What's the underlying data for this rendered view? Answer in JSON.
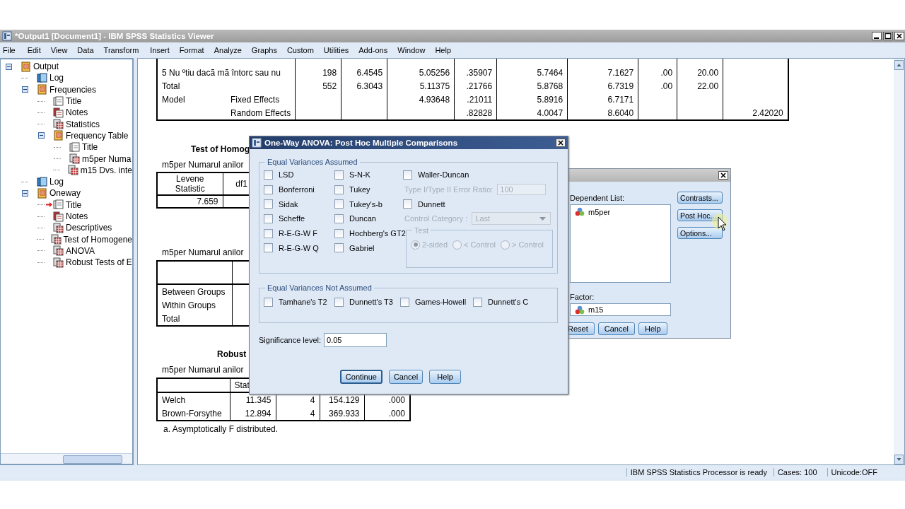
{
  "window": {
    "title": "*Output1 [Document1] - IBM SPSS Statistics Viewer"
  },
  "menu": [
    "File",
    "Edit",
    "View",
    "Data",
    "Transform",
    "Insert",
    "Format",
    "Analyze",
    "Graphs",
    "Custom",
    "Utilities",
    "Add-ons",
    "Window",
    "Help"
  ],
  "navigator": {
    "items": [
      {
        "label": "Output",
        "kind": "book",
        "current": false,
        "expanded": true,
        "children": [
          {
            "label": "Log",
            "kind": "log",
            "current": false
          },
          {
            "label": "Frequencies",
            "kind": "book",
            "current": false,
            "expanded": true,
            "children": [
              {
                "label": "Title",
                "kind": "title",
                "current": false
              },
              {
                "label": "Notes",
                "kind": "notes",
                "current": false
              },
              {
                "label": "Statistics",
                "kind": "table",
                "current": false
              },
              {
                "label": "Frequency Table",
                "kind": "book",
                "current": false,
                "expanded": true,
                "children": [
                  {
                    "label": "Title",
                    "kind": "title",
                    "current": false
                  },
                  {
                    "label": "m5per Numa",
                    "kind": "table",
                    "current": false
                  },
                  {
                    "label": "m15 Dvs. inte",
                    "kind": "table",
                    "current": false
                  }
                ]
              }
            ]
          },
          {
            "label": "Log",
            "kind": "log",
            "current": false
          },
          {
            "label": "Oneway",
            "kind": "book",
            "current": false,
            "expanded": true,
            "children": [
              {
                "label": "Title",
                "kind": "title",
                "current": true
              },
              {
                "label": "Notes",
                "kind": "notes",
                "current": false
              },
              {
                "label": "Descriptives",
                "kind": "table",
                "current": false
              },
              {
                "label": "Test of Homogene",
                "kind": "table",
                "current": false
              },
              {
                "label": "ANOVA",
                "kind": "table",
                "current": false
              },
              {
                "label": "Robust Tests of E",
                "kind": "table",
                "current": false
              }
            ]
          }
        ]
      }
    ]
  },
  "output": {
    "descriptives": {
      "rows": [
        {
          "label": "5 Nu ºtiu dacã mã întorc sau nu",
          "column_3": "198",
          "column_4": "6.4545",
          "column_5": "5.05256",
          "column_6": ".35907",
          "column_7": "5.7464",
          "column_8": "7.1627",
          "column_9": ".00",
          "column_10": "20.00"
        },
        {
          "label": "Total",
          "column_3": "552",
          "column_4": "6.3043",
          "column_5": "5.11375",
          "column_6": ".21766",
          "column_7": "5.8768",
          "column_8": "6.7319",
          "column_9": ".00",
          "column_10": "22.00"
        },
        {
          "label": "Model",
          "sublabel": "Fixed Effects",
          "column_5": "4.93648",
          "column_6": ".21011",
          "column_7": "5.8916",
          "column_8": "6.7171"
        },
        {
          "sublabel": "Random Effects",
          "column_6": ".82828",
          "column_7": "4.0047",
          "column_8": "8.6040",
          "column_11": "2.42020"
        }
      ]
    },
    "homogeneity": {
      "title": "Test of Homog",
      "subtitle": "m5per Numarul anilor",
      "columns": [
        "Levene Statistic",
        "df1"
      ],
      "rows": [
        [
          "7.659"
        ]
      ]
    },
    "anova": {
      "subtitle": "m5per Numarul anilor",
      "rows": [
        "Between Groups",
        "Within Groups",
        "Total"
      ]
    },
    "robust": {
      "title": "Robust",
      "subtitle": "m5per Numarul anilor",
      "columns": [
        "Stat"
      ],
      "rows": [
        {
          "label": "Welch",
          "values": [
            "11.345",
            "4",
            "154.129",
            ".000"
          ]
        },
        {
          "label": "Brown-Forsythe",
          "values": [
            "12.894",
            "4",
            "369.933",
            ".000"
          ]
        }
      ],
      "footnote": "a. Asymptotically F distributed."
    }
  },
  "oneway_dialog": {
    "dependent_label": "Dependent List:",
    "dependent_items": [
      "m5per"
    ],
    "factor_label": "Factor:",
    "factor_value": "m15",
    "side_buttons": [
      "Contrasts...",
      "Post Hoc...",
      "Options..."
    ],
    "buttons": [
      "Reset",
      "Cancel",
      "Help"
    ]
  },
  "posthoc_dialog": {
    "title": "One-Way ANOVA: Post Hoc Multiple Comparisons",
    "equal_assumed": {
      "title": "Equal Variances Assumed",
      "column_1": [
        {
          "label": "LSD",
          "checked": false
        },
        {
          "label": "Bonferroni",
          "checked": false
        },
        {
          "label": "Sidak",
          "checked": false
        },
        {
          "label": "Scheffe",
          "checked": false
        },
        {
          "label": "R-E-G-W F",
          "checked": false
        },
        {
          "label": "R-E-G-W Q",
          "checked": false
        }
      ],
      "column_2": [
        {
          "label": "S-N-K",
          "checked": false
        },
        {
          "label": "Tukey",
          "checked": false
        },
        {
          "label": "Tukey's-b",
          "checked": false
        },
        {
          "label": "Duncan",
          "checked": false
        },
        {
          "label": "Hochberg's GT2",
          "checked": false
        },
        {
          "label": "Gabriel",
          "checked": false
        }
      ],
      "waller_duncan": {
        "label": "Waller-Duncan",
        "checked": false
      },
      "error_ratio": {
        "label": "Type I/Type II Error Ratio:",
        "value": "100",
        "disabled": true
      },
      "dunnett": {
        "label": "Dunnett",
        "checked": false
      },
      "control_category": {
        "label": "Control Category :",
        "value": "Last",
        "disabled": true
      },
      "test": {
        "title": "Test",
        "disabled": true,
        "options": [
          {
            "label": "2-sided",
            "selected": true
          },
          {
            "label": "< Control",
            "selected": false
          },
          {
            "label": "> Control",
            "selected": false
          }
        ]
      }
    },
    "equal_not_assumed": {
      "title": "Equal Variances Not Assumed",
      "options": [
        {
          "label": "Tamhane's T2",
          "checked": false
        },
        {
          "label": "Dunnett's T3",
          "checked": false
        },
        {
          "label": "Games-Howell",
          "checked": false
        },
        {
          "label": "Dunnett's C",
          "checked": false
        }
      ]
    },
    "significance": {
      "label": "Significance level:",
      "value": "0.05"
    },
    "buttons": [
      {
        "label": "Continue",
        "default": true
      },
      {
        "label": "Cancel",
        "default": false
      },
      {
        "label": "Help",
        "default": false
      }
    ]
  },
  "status_bar": {
    "message": "IBM SPSS Statistics Processor is ready",
    "cases": "Cases: 100",
    "unicode": "Unicode:OFF"
  }
}
